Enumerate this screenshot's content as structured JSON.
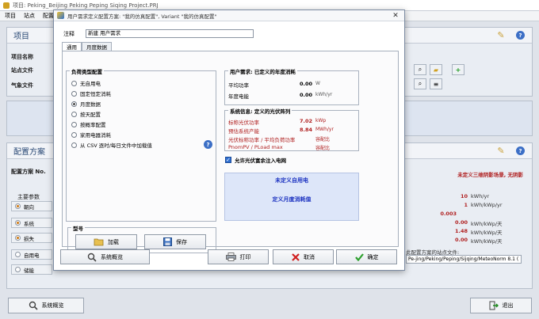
{
  "main_window": {
    "title": "项目: Peking_Beijing Peking Peping Siqing Project.PRJ",
    "menu": [
      "项目",
      "站点",
      "配置"
    ],
    "project_panel": {
      "heading": "项目",
      "fields": [
        "项目名称",
        "站点文件",
        "气象文件"
      ]
    },
    "config_panel": {
      "heading": "配置方案",
      "variant_label": "配置方案 No.",
      "params_label": "主要参数",
      "radios": [
        "朝向",
        "系统",
        "损失",
        "自用电",
        "储能"
      ],
      "right_title": "未定义三维阴影场景, 无阴影",
      "right_values": [
        {
          "value": "10",
          "unit": "kWh/yr"
        },
        {
          "value": "1",
          "unit": "kWh/kWp/yr"
        },
        {
          "value": "0.003",
          "unit": ""
        },
        {
          "value": "0.00",
          "unit": "kWh/kWp/天"
        },
        {
          "value": "1.48",
          "unit": "kWh/kWp/天"
        },
        {
          "value": "0.00",
          "unit": "kWh/kWp/天"
        }
      ],
      "weather_label": "此配置方案的站点文件:",
      "weather_path": "Pe-jing/Peking/Peping/Sijqing/MeteoNorm 8.1 ("
    },
    "bottom": {
      "overview_label": "系统概览",
      "exit_label": "退出"
    }
  },
  "dialog": {
    "title": "用户需求定义配置方案: \"我的仿真配置\", Variant \"我的仿真配置\"",
    "comment_label": "注释",
    "comment_value": "新建 用户需求",
    "tabs": [
      "通用",
      "月度数据"
    ],
    "load_type": {
      "heading": "负荷类型配置",
      "options": [
        {
          "label": "无自用电",
          "selected": false
        },
        {
          "label": "固定恒定消耗",
          "selected": false
        },
        {
          "label": "月度数据",
          "selected": true
        },
        {
          "label": "按天配置",
          "selected": false
        },
        {
          "label": "按概率配置",
          "selected": false
        },
        {
          "label": "家用电器消耗",
          "selected": false
        },
        {
          "label": "从 CSV 逐时/每日文件中加载值",
          "selected": false
        }
      ]
    },
    "user_needs": {
      "heading": "用户需求: 已定义的年度消耗",
      "rows": [
        {
          "label": "平均功率",
          "value": "0.00",
          "unit": "W"
        },
        {
          "label": "年度电能",
          "value": "0.00",
          "unit": "kWh/yr"
        }
      ]
    },
    "system_info": {
      "heading": "系统信息: 定义的光伏阵列",
      "rows": [
        {
          "label": "标称光伏功率",
          "value": "7.02",
          "unit": "kWp"
        },
        {
          "label": "预估系统产能",
          "value": "8.84",
          "unit": "MWh/yr"
        },
        {
          "label": "光伏标称功率 / 平均负荷功率",
          "value": "",
          "unit": "容配比"
        },
        {
          "label": "PnomPV / PLoad max",
          "value": "",
          "unit": "容配比"
        }
      ]
    },
    "grid_injection_label": "允许光伏富余注入电网",
    "grid_injection_checked": true,
    "notice": {
      "line1": "未定义自用电",
      "line2": "定义月度消耗值"
    },
    "model": {
      "heading": "型号",
      "load_label": "加载",
      "save_label": "保存"
    },
    "buttons": {
      "overview": "系统概览",
      "print": "打印",
      "cancel": "取消",
      "ok": "确定"
    },
    "colors": {
      "accent_red": "#b02020",
      "notice_blue": "#1a30c0",
      "ok_green": "#2da02d",
      "cancel_red": "#d02020"
    }
  }
}
